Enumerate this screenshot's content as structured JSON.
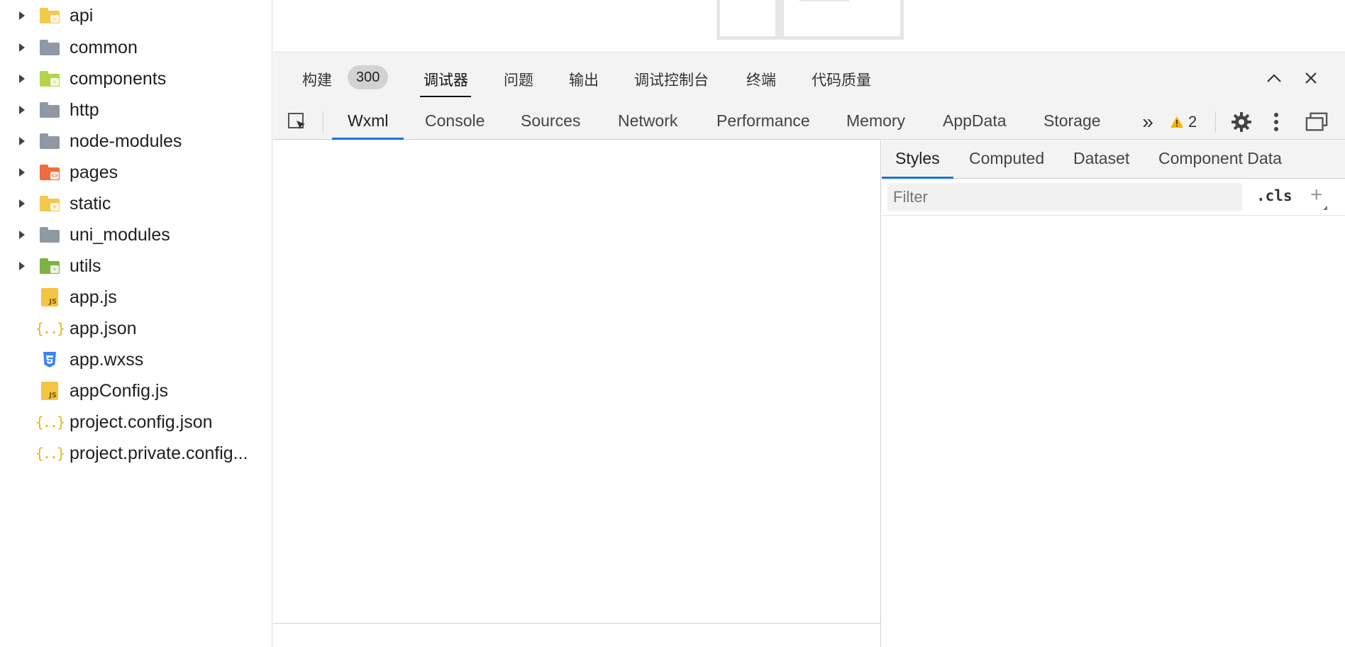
{
  "file_tree": {
    "folders": [
      {
        "name": "api",
        "color": "#f2c94c",
        "badge": "+"
      },
      {
        "name": "common",
        "color": "#8e99a4",
        "badge": ""
      },
      {
        "name": "components",
        "color": "#b6d44a",
        "badge": "+"
      },
      {
        "name": "http",
        "color": "#8e99a4",
        "badge": ""
      },
      {
        "name": "node-modules",
        "color": "#8e99a4",
        "badge": ""
      },
      {
        "name": "pages",
        "color": "#ef6c3e",
        "badge": "<>"
      },
      {
        "name": "static",
        "color": "#f2c94c",
        "badge": "≡"
      },
      {
        "name": "uni_modules",
        "color": "#8e99a4",
        "badge": ""
      },
      {
        "name": "utils",
        "color": "#7cb342",
        "badge": "+"
      }
    ],
    "files": [
      {
        "name": "app.js",
        "icon": "js-file-icon",
        "icon_text": "JS"
      },
      {
        "name": "app.json",
        "icon": "json-file-icon",
        "icon_text": "{..}"
      },
      {
        "name": "app.wxss",
        "icon": "css-file-icon",
        "icon_text": ""
      },
      {
        "name": "appConfig.js",
        "icon": "js-file-icon",
        "icon_text": "JS"
      },
      {
        "name": "project.config.json",
        "icon": "json-file-icon",
        "icon_text": "{..}"
      },
      {
        "name": "project.private.config...",
        "icon": "json-file-icon",
        "icon_text": "{..}"
      }
    ]
  },
  "panel": {
    "tabs": [
      "构建",
      "调试器",
      "问题",
      "输出",
      "调试控制台",
      "终端",
      "代码质量"
    ],
    "build_count": "300",
    "active_tab": "调试器"
  },
  "devtools": {
    "tabs": [
      "Wxml",
      "Console",
      "Sources",
      "Network",
      "Performance",
      "Memory",
      "AppData",
      "Storage"
    ],
    "active_tab": "Wxml",
    "more_label": "»",
    "warning_count": "2"
  },
  "styles_pane": {
    "tabs": [
      "Styles",
      "Computed",
      "Dataset",
      "Component Data"
    ],
    "active_tab": "Styles",
    "filter_placeholder": "Filter",
    "cls_label": ".cls",
    "add_label": "+"
  },
  "colors": {
    "accent": "#1a73e8",
    "warning": "#f4b400",
    "json_icon": "#e6b422",
    "css_icon": "#3b82f6"
  }
}
